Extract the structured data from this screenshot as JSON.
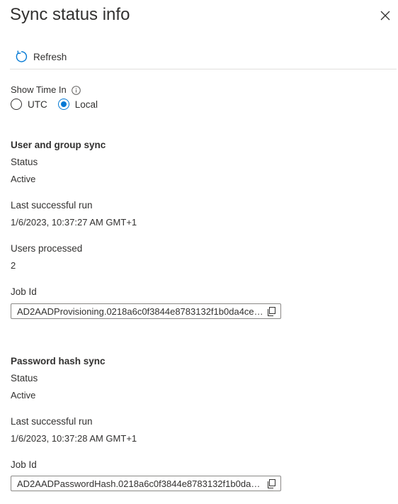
{
  "panel": {
    "title": "Sync status info",
    "close_icon": "close-icon"
  },
  "toolbar": {
    "refresh_label": "Refresh",
    "refresh_icon": "refresh-icon"
  },
  "time_options": {
    "label": "Show Time In",
    "info_icon": "info-icon",
    "options": [
      {
        "label": "UTC",
        "checked": false
      },
      {
        "label": "Local",
        "checked": true
      }
    ]
  },
  "user_group_sync": {
    "heading": "User and group sync",
    "status_label": "Status",
    "status_value": "Active",
    "last_run_label": "Last successful run",
    "last_run_value": "1/6/2023, 10:37:27 AM GMT+1",
    "users_processed_label": "Users processed",
    "users_processed_value": "2",
    "job_id_label": "Job Id",
    "job_id_value": "AD2AADProvisioning.0218a6c0f3844e8783132f1b0da4ce3..."
  },
  "password_hash_sync": {
    "heading": "Password hash sync",
    "status_label": "Status",
    "status_value": "Active",
    "last_run_label": "Last successful run",
    "last_run_value": "1/6/2023, 10:37:28 AM GMT+1",
    "job_id_label": "Job Id",
    "job_id_value": "AD2AADPasswordHash.0218a6c0f3844e8783132f1b0da4c..."
  },
  "colors": {
    "accent": "#0078d4",
    "text": "#323130",
    "border": "#8a8886",
    "divider": "#e1dfdd"
  }
}
